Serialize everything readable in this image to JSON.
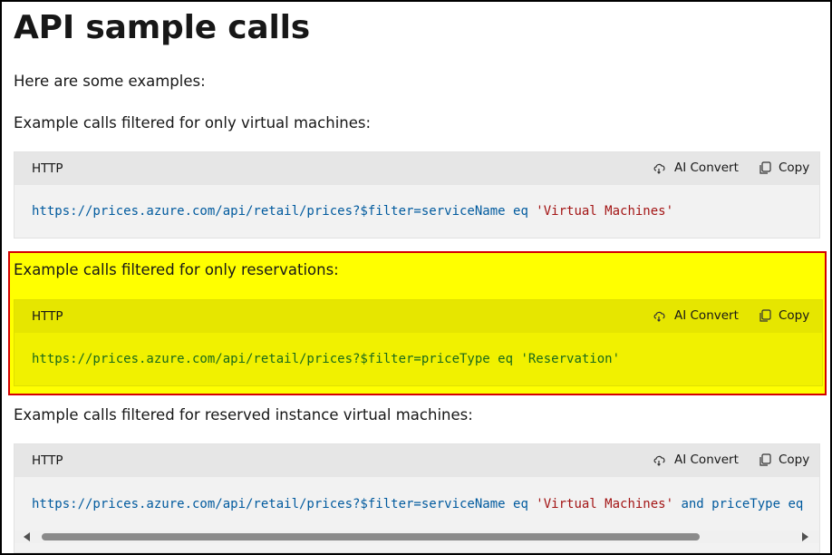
{
  "page": {
    "title": "API sample calls",
    "intro": "Here are some examples:"
  },
  "sections": [
    {
      "description": "Example calls filtered for only virtual machines:",
      "lang": "HTTP",
      "ai_convert_label": "AI Convert",
      "copy_label": "Copy",
      "code_url": "https://prices.azure.com/api/retail/prices?$filter=serviceName eq ",
      "code_string": "'Virtual Machines'"
    },
    {
      "description": "Example calls filtered for only reservations:",
      "lang": "HTTP",
      "ai_convert_label": "AI Convert",
      "copy_label": "Copy",
      "code_url": "https://prices.azure.com/api/retail/prices?$filter=priceType eq ",
      "code_string": "'Reservation'"
    },
    {
      "description": "Example calls filtered for reserved instance virtual machines:",
      "lang": "HTTP",
      "ai_convert_label": "AI Convert",
      "copy_label": "Copy",
      "code_url": "https://prices.azure.com/api/retail/prices?$filter=serviceName eq ",
      "code_string": "'Virtual Machines'",
      "code_tail": " and priceType eq"
    }
  ],
  "colors": {
    "highlight": "#ffff00",
    "highlight_border": "#d40000",
    "code_text": "#005a9e",
    "code_string": "#a31515"
  },
  "icons": {
    "ai_convert": "cloud-sync-icon",
    "copy": "copy-icon"
  }
}
